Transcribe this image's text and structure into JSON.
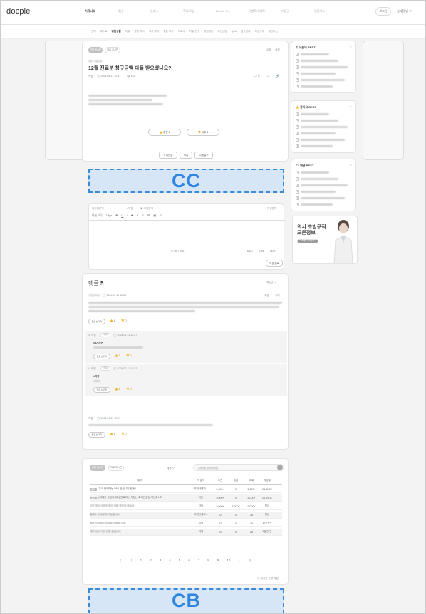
{
  "header": {
    "logo": "docple",
    "nav": [
      "커뮤니티",
      "자산",
      "클래스",
      "학회/모임",
      "Bandle Pro",
      "이벤트/이벤트",
      "이용권",
      "인증게시"
    ],
    "btn1": "로그인",
    "user": "김지환 님 ∨"
  },
  "subnav": {
    "items": [
      "전체",
      "베스트",
      "병원생활",
      "자유",
      "병원·의사",
      "의사·투자",
      "결혼·육아",
      "의료사",
      "학술·연구",
      "병원행정",
      "고민상담",
      "Q&A",
      "임상공유",
      "모임구직",
      "물건나눔"
    ],
    "active_index": 2
  },
  "post": {
    "category_tab": "전체 게시판",
    "tab2": "의료 게시판",
    "meta_top": "자유 · 의료사항",
    "title": "12월 진료분 청구금액 다들 받으셨나요?",
    "author": "익명",
    "date": "2024.01.11 12:57",
    "views": "146",
    "edit": "수정",
    "delete": "삭제",
    "comment_count": "6",
    "like_label": "추천",
    "like_count": "1",
    "dislike_label": "비추",
    "dislike_count": "1",
    "prev": "< 이전글",
    "list": "목록",
    "next": "다음글 >"
  },
  "placeholders": {
    "cc": "CC",
    "cb": "CB"
  },
  "editor": {
    "nickname": "아이디선택",
    "opt1": "익명",
    "opt2": "고정방식",
    "font": "나눔고딕",
    "size": "13px",
    "counter": "0 / 300 / 3000",
    "mode1": "Editor",
    "mode2": "HTML",
    "mode3": "TEXT",
    "submit": "작성 완료",
    "write_policy": "작성정책"
  },
  "comments": {
    "title": "댓글",
    "count": "5",
    "sort": "최신순",
    "items": [
      {
        "author": "서빈(9922)",
        "date": "2024.01.11 12:57",
        "edit": "수정",
        "delete": "삭제",
        "reply_btn": "답글 남기기",
        "likes": "1",
        "dislikes": "0"
      },
      {
        "author": "익명",
        "badge": "작성자",
        "date": "2024.01.11 12:57",
        "body": "#4가지면",
        "reply_btn": "답글 남기기",
        "likes": "1",
        "dislikes": "0"
      },
      {
        "author": "익명",
        "badge": "작성자",
        "date": "2024.01.11 12:57",
        "body": "#막장",
        "reply_btn": "답글 남기기",
        "likes": "1",
        "dislikes": "0"
      },
      {
        "author": "익명",
        "date": "2024.01.11 12:57",
        "reply_btn": "답글 남기기",
        "likes": "1",
        "dislikes": "0"
      }
    ]
  },
  "best": {
    "box1": "오늘의 BEST",
    "box2": "좋아요 BEST",
    "box3": "댓글 BEST"
  },
  "banner": {
    "line1": "의사 초빙구직",
    "line2": "모든정보",
    "btn": "자세히 보러가기"
  },
  "list": {
    "tab1": "전체 게시판",
    "tab2": "의료 게시판",
    "filter": "제목",
    "search_placeholder": "검색어를 입력해주세요",
    "headers": [
      "제목",
      "작성자",
      "추천",
      "댓글",
      "조회",
      "작성일"
    ],
    "rows": [
      {
        "tag": "공지",
        "title": "유료 판매하는 PAS 안됩니다 필독!!",
        "writer": "회계사엔파...",
        "likes": "5,000+",
        "comments": "0",
        "views": "5,000+",
        "date": "23.11.22"
      },
      {
        "tag": "공지",
        "title": "[회계가 궁금하세요] 진료비 신속정산 회계컨설팅 가능합니다",
        "writer": "자동",
        "likes": "5,000+",
        "comments": "0",
        "views": "5,000+",
        "date": "23.09.11"
      },
      {
        "tag": "",
        "title": "근무 의사 사업자 재산 이동 특진의 중요성",
        "writer": "자동",
        "likes": "5,000+",
        "comments": "5,000+",
        "views": "5,000+",
        "date": "방금"
      },
      {
        "tag": "",
        "title": "월세도 소득공제 가능합니다",
        "writer": "의원인계자...",
        "likes": "22",
        "comments": "0",
        "views": "28",
        "date": "방금"
      },
      {
        "tag": "",
        "title": "청년 신규창업 임대료 지원에 관해",
        "writer": "익명",
        "likes": "22",
        "comments": "0",
        "views": "28",
        "date": "1시간 전"
      },
      {
        "tag": "",
        "title": "세무 신고 기간 진행 중입니다",
        "writer": "익명",
        "likes": "22",
        "comments": "0",
        "views": "28",
        "date": "1일전 전"
      }
    ],
    "pages": [
      "《",
      "〈",
      "1",
      "2",
      "3",
      "4",
      "5",
      "6",
      "7",
      "8",
      "9",
      "10",
      "〉",
      "》"
    ],
    "footer_link": "ⓘ 게시판 운영 지침"
  },
  "colors": {
    "placeholder_border": "#3a8bdc",
    "placeholder_fill": "#d6e6f6",
    "placeholder_text": "#2e86de"
  }
}
